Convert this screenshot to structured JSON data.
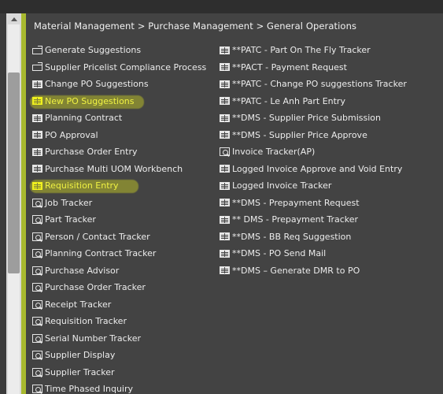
{
  "breadcrumb": "Material Management > Purchase Management > General Operations",
  "left_items": [
    {
      "label": "Generate Suggestions",
      "icon": "process-icon",
      "highlight": false
    },
    {
      "label": "Supplier Pricelist Compliance Process",
      "icon": "process-icon",
      "highlight": false
    },
    {
      "label": "Change PO Suggestions",
      "icon": "list-icon",
      "highlight": false
    },
    {
      "label": "New PO Suggestions",
      "icon": "list-icon",
      "highlight": true
    },
    {
      "label": "Planning Contract",
      "icon": "list-icon",
      "highlight": false
    },
    {
      "label": "PO Approval",
      "icon": "list-icon",
      "highlight": false
    },
    {
      "label": "Purchase Order Entry",
      "icon": "list-icon",
      "highlight": false
    },
    {
      "label": "Purchase Multi UOM Workbench",
      "icon": "list-icon",
      "highlight": false
    },
    {
      "label": "Requisition Entry",
      "icon": "list-icon",
      "highlight": true
    },
    {
      "label": "Job Tracker",
      "icon": "tracker-icon",
      "highlight": false
    },
    {
      "label": "Part Tracker",
      "icon": "tracker-icon",
      "highlight": false
    },
    {
      "label": "Person / Contact Tracker",
      "icon": "tracker-icon",
      "highlight": false
    },
    {
      "label": "Planning Contract Tracker",
      "icon": "tracker-icon",
      "highlight": false
    },
    {
      "label": "Purchase Advisor",
      "icon": "tracker-icon",
      "highlight": false
    },
    {
      "label": "Purchase Order Tracker",
      "icon": "tracker-icon",
      "highlight": false
    },
    {
      "label": "Receipt Tracker",
      "icon": "tracker-icon",
      "highlight": false
    },
    {
      "label": "Requisition Tracker",
      "icon": "tracker-icon",
      "highlight": false
    },
    {
      "label": "Serial Number Tracker",
      "icon": "tracker-icon",
      "highlight": false
    },
    {
      "label": "Supplier Display",
      "icon": "tracker-icon",
      "highlight": false
    },
    {
      "label": "Supplier Tracker",
      "icon": "tracker-icon",
      "highlight": false
    },
    {
      "label": "Time Phased Inquiry",
      "icon": "tracker-icon",
      "highlight": false
    }
  ],
  "right_items": [
    {
      "label": "**PATC - Part On The Fly Tracker",
      "icon": "list-icon"
    },
    {
      "label": "**PACT - Payment Request",
      "icon": "list-icon"
    },
    {
      "label": "**PATC - Change PO suggestions Tracker",
      "icon": "list-icon"
    },
    {
      "label": "**PATC - Le Anh Part Entry",
      "icon": "list-icon"
    },
    {
      "label": "**DMS - Supplier Price Submission",
      "icon": "list-icon"
    },
    {
      "label": "**DMS - Supplier Price Approve",
      "icon": "list-icon"
    },
    {
      "label": "Invoice Tracker(AP)",
      "icon": "tracker-icon"
    },
    {
      "label": "Logged Invoice Approve and Void Entry",
      "icon": "list-icon"
    },
    {
      "label": "Logged Invoice Tracker",
      "icon": "list-icon"
    },
    {
      "label": "**DMS - Prepayment Request",
      "icon": "list-icon"
    },
    {
      "label": "** DMS - Prepayment Tracker",
      "icon": "list-icon"
    },
    {
      "label": "**DMS - BB Req Suggestion",
      "icon": "list-icon"
    },
    {
      "label": "**DMS - PO Send Mail",
      "icon": "list-icon"
    },
    {
      "label": "**DMS – Generate DMR to PO",
      "icon": "list-icon"
    }
  ],
  "colors": {
    "panel_bg": "#434343",
    "accent_bar": "#a8b92f",
    "highlighter": "#f2f020"
  }
}
